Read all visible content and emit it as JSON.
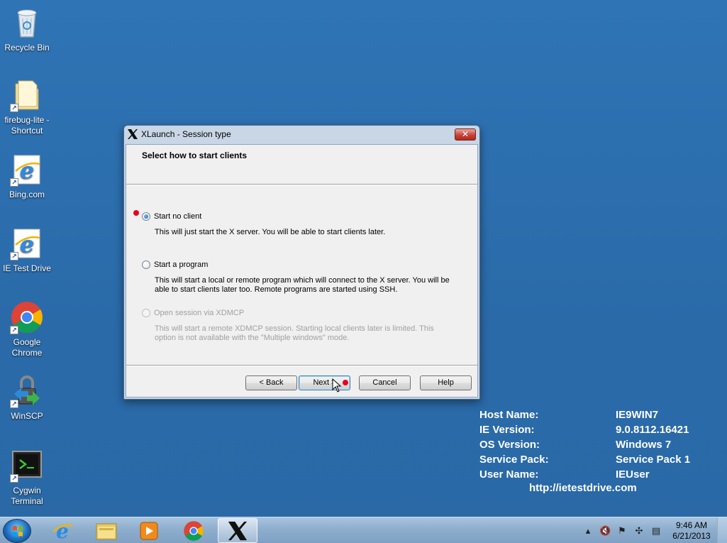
{
  "desktop": {
    "icons": [
      {
        "label": "Recycle Bin",
        "icon": "recycle-bin-icon"
      },
      {
        "label": "firebug-lite - Shortcut",
        "icon": "folder-icon"
      },
      {
        "label": "Bing.com",
        "icon": "ie-icon"
      },
      {
        "label": "IE Test Drive",
        "icon": "ie-icon"
      },
      {
        "label": "Google Chrome",
        "icon": "chrome-icon"
      },
      {
        "label": "WinSCP",
        "icon": "winscp-icon"
      },
      {
        "label": "Cygwin Terminal",
        "icon": "terminal-icon"
      }
    ]
  },
  "dialog": {
    "title": "XLaunch - Session type",
    "heading": "Select how to start clients",
    "options": [
      {
        "label": "Start no client",
        "description": "This will just start the X server. You will be able to start clients later.",
        "checked": true,
        "enabled": true
      },
      {
        "label": "Start a program",
        "description": "This will start a local or remote program which will connect to the X server. You will be able to start clients later too. Remote programs are started using SSH.",
        "checked": false,
        "enabled": true
      },
      {
        "label": "Open session via XDMCP",
        "description": "This will start a remote XDMCP session. Starting local clients later is limited. This option is not available with the \"Multiple windows\" mode.",
        "checked": false,
        "enabled": false
      }
    ],
    "buttons": {
      "back": "< Back",
      "next": "Next >",
      "cancel": "Cancel",
      "help": "Help"
    }
  },
  "info": {
    "rows": [
      {
        "key": "Host Name:",
        "value": "IE9WIN7"
      },
      {
        "key": "IE Version:",
        "value": "9.0.8112.16421"
      },
      {
        "key": "OS Version:",
        "value": "Windows 7"
      },
      {
        "key": "Service Pack:",
        "value": "Service Pack 1"
      },
      {
        "key": "User Name:",
        "value": "IEUser"
      }
    ],
    "url": "http://ietestdrive.com"
  },
  "taskbar": {
    "items": [
      "ie-icon",
      "explorer-icon",
      "media-player-icon",
      "chrome-icon",
      "xlaunch-icon"
    ],
    "clock": {
      "time": "9:46 AM",
      "date": "6/21/2013"
    }
  },
  "colors": {
    "desktop": "#2b6eae",
    "highlight_dot": "#e8001c"
  }
}
